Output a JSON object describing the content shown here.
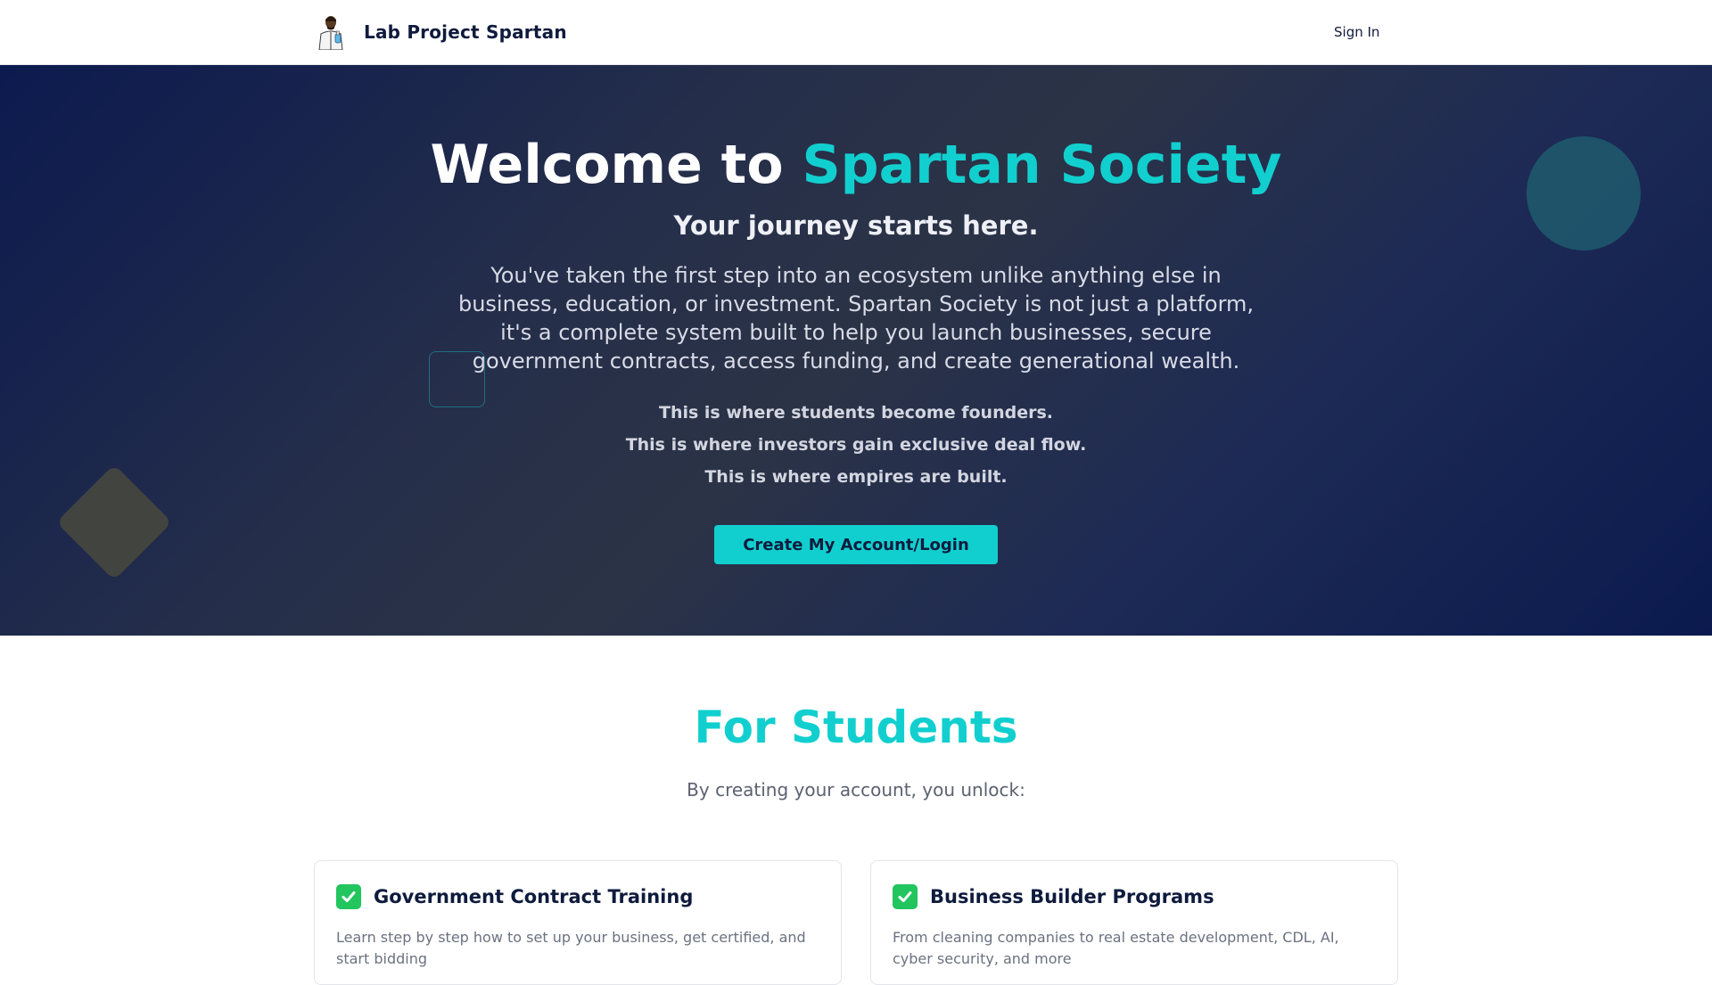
{
  "navbar": {
    "brand_name": "Lab Project Spartan",
    "logo_icon": "scientist-logo-icon",
    "signin_label": "Sign In"
  },
  "hero": {
    "title_prefix": "Welcome to ",
    "title_accent": "Spartan Society",
    "subtitle": "Your journey starts here.",
    "description": "You've taken the first step into an ecosystem unlike anything else in business, education, or investment. Spartan Society is not just a platform, it's a complete system built to help you launch businesses, secure government contracts, access funding, and create generational wealth.",
    "points": [
      "This is where students become founders.",
      "This is where investors gain exclusive deal flow.",
      "This is where empires are built."
    ],
    "cta_label": "Create My Account/Login"
  },
  "students": {
    "title": "For Students",
    "subtitle": "By creating your account, you unlock:",
    "cards": [
      {
        "icon": "check-mark-icon",
        "title": "Government Contract Training",
        "text": "Learn step by step how to set up your business, get certified, and start bidding"
      },
      {
        "icon": "check-mark-icon",
        "title": "Business Builder Programs",
        "text": "From cleaning companies to real estate development, CDL, AI, cyber security, and more"
      }
    ]
  },
  "colors": {
    "accent": "#12cfcf",
    "navy": "#0f1b3d",
    "check": "#22c55e"
  }
}
